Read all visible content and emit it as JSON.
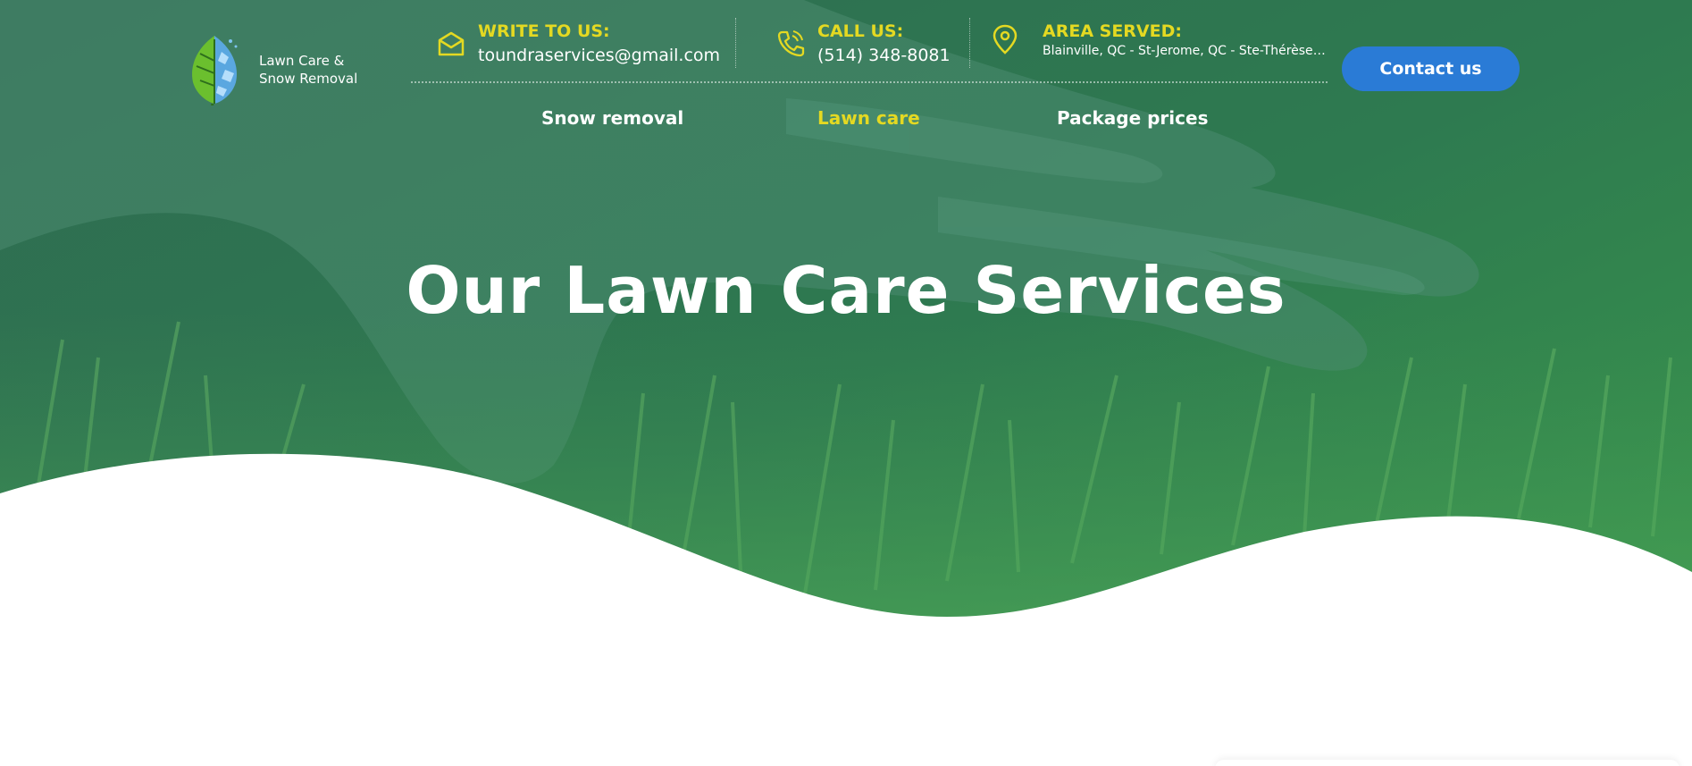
{
  "brand": {
    "logo_text_line1": "Lawn Care &",
    "logo_text_line2": "Snow Removal"
  },
  "contacts": {
    "email": {
      "label": "WRITE TO US:",
      "value": "toundraservices@gmail.com"
    },
    "phone": {
      "label": "CALL US:",
      "value": "(514) 348-8081"
    },
    "area": {
      "label": "AREA SERVED:",
      "value": "Blainville, QC - St-Jerome, QC - Ste-Thérèse, ..."
    }
  },
  "header": {
    "contact_button": "Contact us"
  },
  "nav": [
    {
      "label": "Snow removal",
      "active": false
    },
    {
      "label": "Lawn care",
      "active": true
    },
    {
      "label": "Package prices",
      "active": false
    }
  ],
  "hero": {
    "title": "Our Lawn Care Services"
  },
  "colors": {
    "accent_yellow": "#e4d922",
    "button_blue": "#2a7bd6",
    "hero_green": "#2f7b4e"
  },
  "icons": [
    "envelope-icon",
    "phone-icon",
    "location-pin-icon",
    "leaf-snowflake-logo-icon"
  ]
}
